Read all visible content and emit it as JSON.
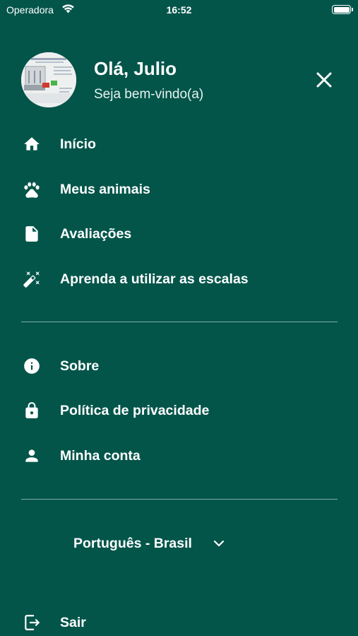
{
  "status_bar": {
    "carrier": "Operadora",
    "time": "16:52",
    "battery_level": 1.0
  },
  "profile": {
    "greeting": "Olá, Julio",
    "subtitle": "Seja bem-vindo(a)"
  },
  "menu": {
    "primary": [
      {
        "label": "Início",
        "icon": "home-icon"
      },
      {
        "label": "Meus animais",
        "icon": "paw-icon"
      },
      {
        "label": "Avaliações",
        "icon": "document-icon"
      },
      {
        "label": "Aprenda a utilizar as escalas",
        "icon": "magic-wand-icon"
      }
    ],
    "secondary": [
      {
        "label": "Sobre",
        "icon": "info-icon"
      },
      {
        "label": "Política de privacidade",
        "icon": "lock-icon"
      },
      {
        "label": "Minha conta",
        "icon": "person-icon"
      }
    ],
    "language": {
      "selected": "Português - Brasil"
    },
    "logout": {
      "label": "Sair",
      "icon": "logout-icon"
    }
  },
  "colors": {
    "background": "#03554a",
    "text": "#ffffff",
    "divider": "#7ea9a3"
  }
}
